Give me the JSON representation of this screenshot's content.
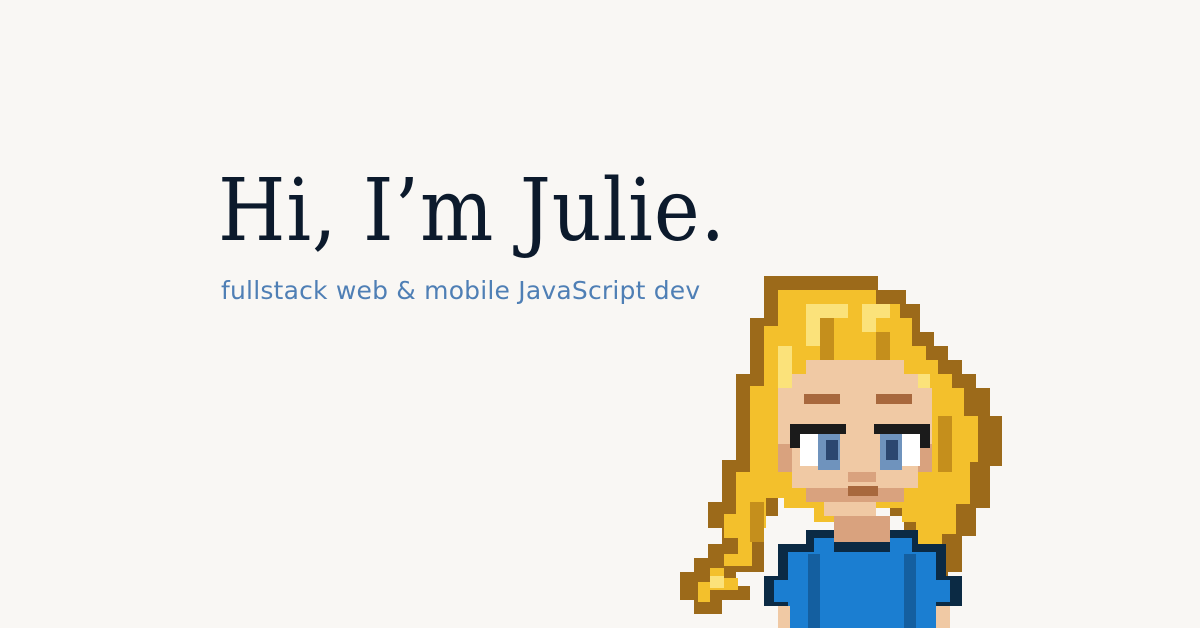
{
  "hero": {
    "headline": "Hi, I’m Julie.",
    "subtitle": "fullstack web & mobile JavaScript dev"
  },
  "avatar": {
    "icon": "pixel-girl-avatar-icon"
  },
  "colors": {
    "background": "#f9f7f4",
    "headline": "#0c1a2c",
    "subtitle": "#4f7fb5",
    "hair": "#f3c02c",
    "hair_shade": "#9c6a1a",
    "skin": "#f0c9a4",
    "shirt": "#1b7ed1"
  }
}
